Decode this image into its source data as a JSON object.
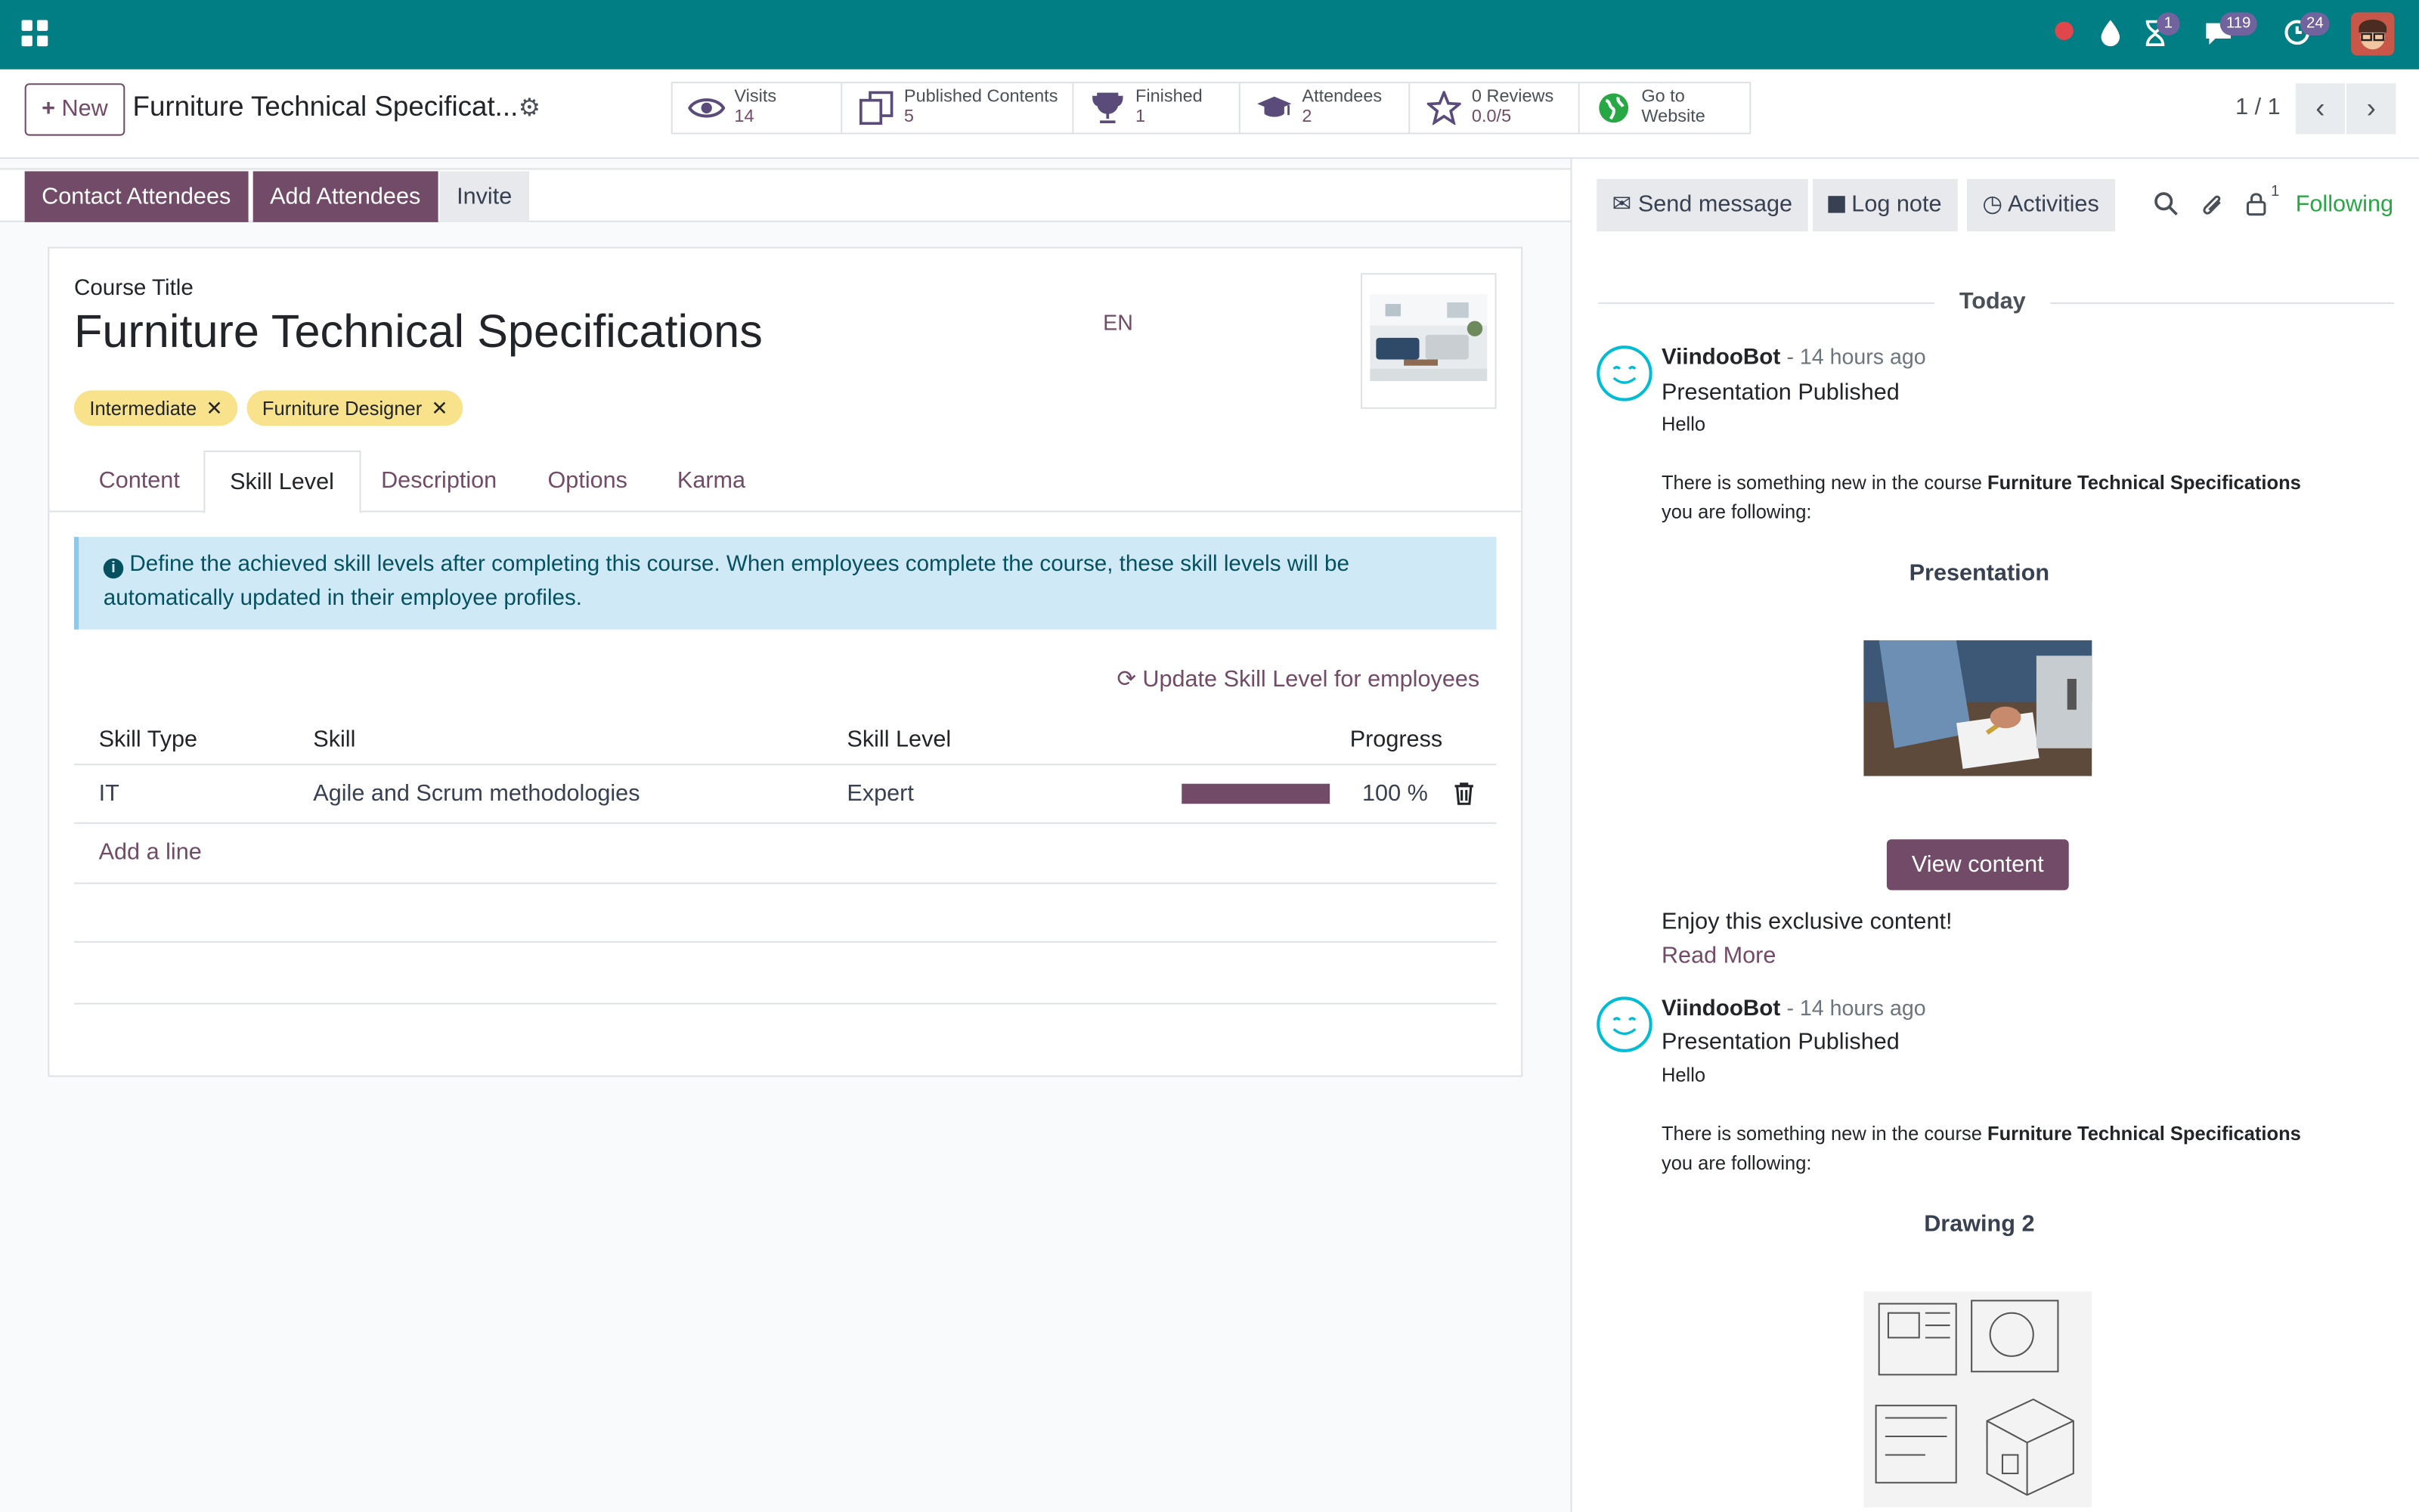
{
  "navbar": {
    "activity_badge": "1",
    "messages_badge": "119",
    "updates_badge": "24",
    "bg_color": "#017e84"
  },
  "control_panel": {
    "new_button": "New",
    "record_title": "Furniture Technical Specificat...",
    "stats": [
      {
        "label": "Visits",
        "value": "14",
        "icon": "eye-icon"
      },
      {
        "label": "Published Contents",
        "value": "5",
        "icon": "copy-icon"
      },
      {
        "label": "Finished",
        "value": "1",
        "icon": "trophy-icon"
      },
      {
        "label": "Attendees",
        "value": "2",
        "icon": "graduation-cap-icon"
      },
      {
        "label": "0 Reviews",
        "value": "0.0/5",
        "icon": "star-icon"
      },
      {
        "label": "Go to",
        "value": "Website",
        "icon": "globe-icon"
      }
    ],
    "pager": "1 / 1"
  },
  "statusbar": {
    "contact_attendees": "Contact Attendees",
    "add_attendees": "Add Attendees",
    "invite": "Invite"
  },
  "form": {
    "course_title_label": "Course Title",
    "course_title": "Furniture Technical Specifications",
    "language": "EN",
    "tags": [
      "Intermediate",
      "Furniture Designer"
    ],
    "tabs": [
      "Content",
      "Skill Level",
      "Description",
      "Options",
      "Karma"
    ],
    "active_tab": "Skill Level",
    "alert": "Define the achieved skill levels after completing this course. When employees complete the course, these skill levels will be automatically updated in their employee profiles.",
    "update_link": "Update Skill Level for employees",
    "table": {
      "headers": [
        "Skill Type",
        "Skill",
        "Skill Level",
        "Progress"
      ],
      "rows": [
        {
          "skill_type": "IT",
          "skill": "Agile and Scrum methodologies",
          "skill_level": "Expert",
          "progress_text": "100 %",
          "progress_fraction": 1.0
        }
      ],
      "add_line": "Add a line"
    }
  },
  "chatter": {
    "send_message": "Send message",
    "log_note": "Log note",
    "activities": "Activities",
    "followers_count": "1",
    "following": "Following",
    "date_separator": "Today",
    "messages": [
      {
        "author": "ViindooBot",
        "time": "- 14 hours ago",
        "subject": "Presentation Published",
        "greeting": "Hello",
        "body_prefix": "There is something new in the course ",
        "body_course": "Furniture Technical Specifications",
        "body_suffix": "you are following:",
        "content_title": "Presentation",
        "button": "View content",
        "footer": "Enjoy this exclusive content!",
        "read_more": "Read More"
      },
      {
        "author": "ViindooBot",
        "time": "- 14 hours ago",
        "subject": "Presentation Published",
        "greeting": "Hello",
        "body_prefix": "There is something new in the course ",
        "body_course": "Furniture Technical Specifications",
        "body_suffix": "you are following:",
        "content_title": "Drawing 2"
      }
    ]
  },
  "colors": {
    "brand": "#714b67",
    "teal": "#017e84",
    "tag_yellow": "#f8e38c",
    "info_bg": "#cfe9f7",
    "following_green": "#28a745"
  }
}
